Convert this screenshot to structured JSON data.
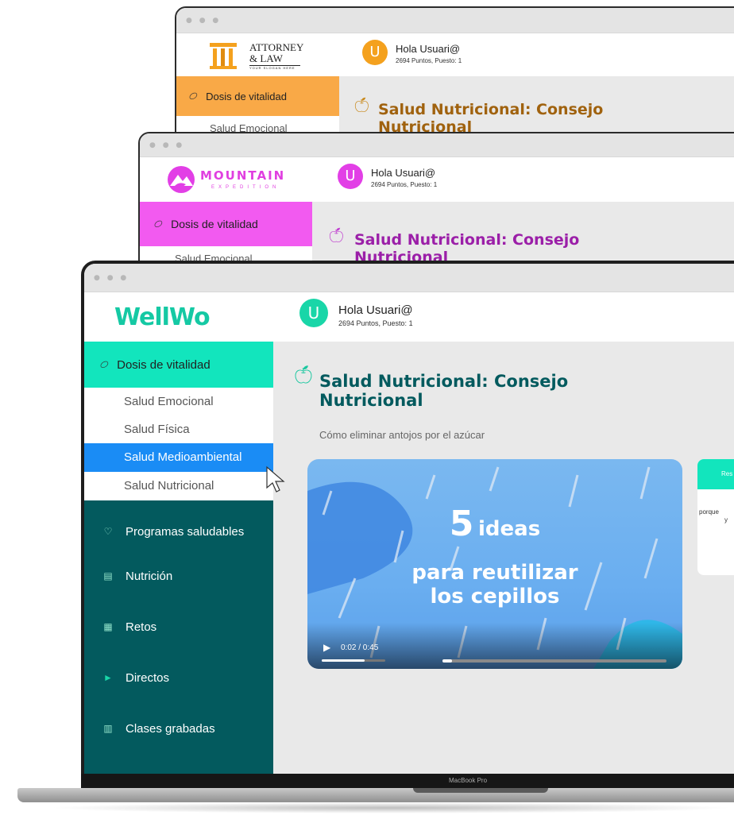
{
  "windows": [
    {
      "brand": {
        "line1": "ATTORNEY",
        "line2": "& LAW",
        "slogan": "YOUR SLOGAN HERE",
        "color": "#c98a1e"
      },
      "user": {
        "avatar_letter": "U",
        "greeting": "Hola Usuari@",
        "points": "2694 Puntos, Puesto: 1",
        "avatar_color": "#f4a11e"
      },
      "nav": {
        "selected": "Dosis de vitalidad",
        "selected_color": "#f9a947",
        "first_sub": "Salud Emocional"
      },
      "page": {
        "title": "Salud Nutricional: Consejo Nutricional",
        "title_color": "#a0620e"
      }
    },
    {
      "brand": {
        "name": "MOUNTAIN",
        "tagline": "EXPEDITION",
        "color": "#e03fe0"
      },
      "user": {
        "avatar_letter": "U",
        "greeting": "Hola Usuari@",
        "points": "2694 Puntos, Puesto: 1",
        "avatar_color": "#e23fe6"
      },
      "nav": {
        "selected": "Dosis de vitalidad",
        "selected_color": "#f25af0",
        "first_sub": "Salud Emocional"
      },
      "page": {
        "title": "Salud Nutricional: Consejo Nutricional",
        "title_color": "#9b1fa8"
      }
    },
    {
      "brand": {
        "name": "WellWo",
        "color": "#15c9a4",
        "accent": "#0d4d6b"
      },
      "user": {
        "avatar_letter": "U",
        "greeting": "Hola Usuari@",
        "points": "2694 Puntos, Puesto: 1",
        "avatar_color": "#19d6a8"
      },
      "nav": {
        "selected": "Dosis de vitalidad",
        "selected_color": "#12e5bd",
        "submenu": [
          {
            "label": "Salud Emocional"
          },
          {
            "label": "Salud Física"
          },
          {
            "label": "Salud Medioambiental"
          },
          {
            "label": "Salud Nutricional"
          }
        ],
        "highlight_color": "#1a8cf5",
        "items": [
          {
            "label": "Programas saludables",
            "icon": "heart-check-icon"
          },
          {
            "label": "Nutrición",
            "icon": "document-icon"
          },
          {
            "label": "Retos",
            "icon": "challenge-icon"
          },
          {
            "label": "Directos",
            "icon": "play-icon"
          },
          {
            "label": "Clases grabadas",
            "icon": "video-library-icon"
          }
        ]
      },
      "page": {
        "title": "Salud Nutricional: Consejo Nutricional",
        "title_color": "#035a5e",
        "subtitle": "Cómo eliminar antojos por el azúcar"
      },
      "video": {
        "big_number": "5",
        "line1": "ideas",
        "line2": "para reutilizar",
        "line3": "los cepillos",
        "time": "0:02 / 0:45",
        "progress": 0.044
      },
      "side_panel": {
        "header": "Res",
        "text_line1": "porque",
        "text_line2": "y"
      }
    }
  ],
  "laptop": {
    "label": "MacBook Pro"
  }
}
